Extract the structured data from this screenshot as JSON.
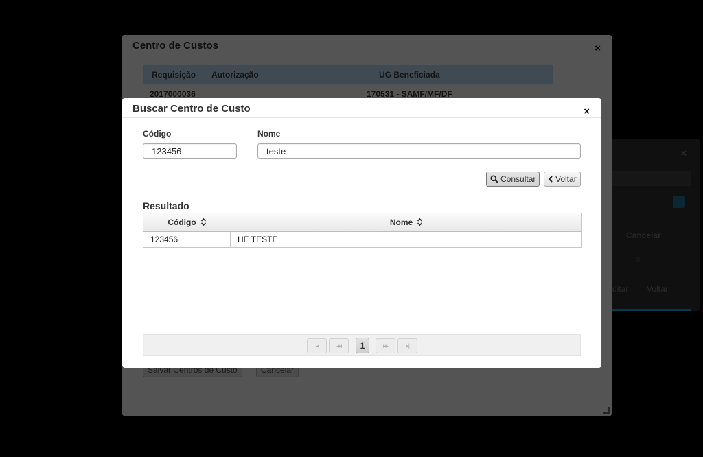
{
  "background": {
    "right_dialog": {
      "close": "×",
      "label": "Cancelar",
      "value": "0",
      "btn1": "ditar",
      "btn2": "Voltar"
    }
  },
  "outer_dialog": {
    "title": "Centro de Custos",
    "close": "×",
    "columns": [
      "Requisição",
      "Autorização",
      "UG Beneficiada"
    ],
    "row": {
      "requisicao": "2017000036",
      "ug": "170531 - SAMF/MF/DF"
    },
    "save_button": "Salvar Centros de Custo",
    "cancel_button": "Cancelar"
  },
  "modal": {
    "title": "Buscar Centro de Custo",
    "close": "×",
    "codigo_label": "Código",
    "codigo_value": "123456",
    "nome_label": "Nome",
    "nome_value": "teste",
    "consultar_label": "Consultar",
    "voltar_label": "Voltar",
    "result_title": "Resultado",
    "table": {
      "headers": [
        "Código",
        "Nome"
      ],
      "rows": [
        {
          "codigo": "123456",
          "nome": "HE TESTE"
        }
      ]
    },
    "pagination": {
      "first": "|◂",
      "prev": "◂◂",
      "page": "1",
      "next": "▸▸",
      "last": "▸|"
    }
  }
}
